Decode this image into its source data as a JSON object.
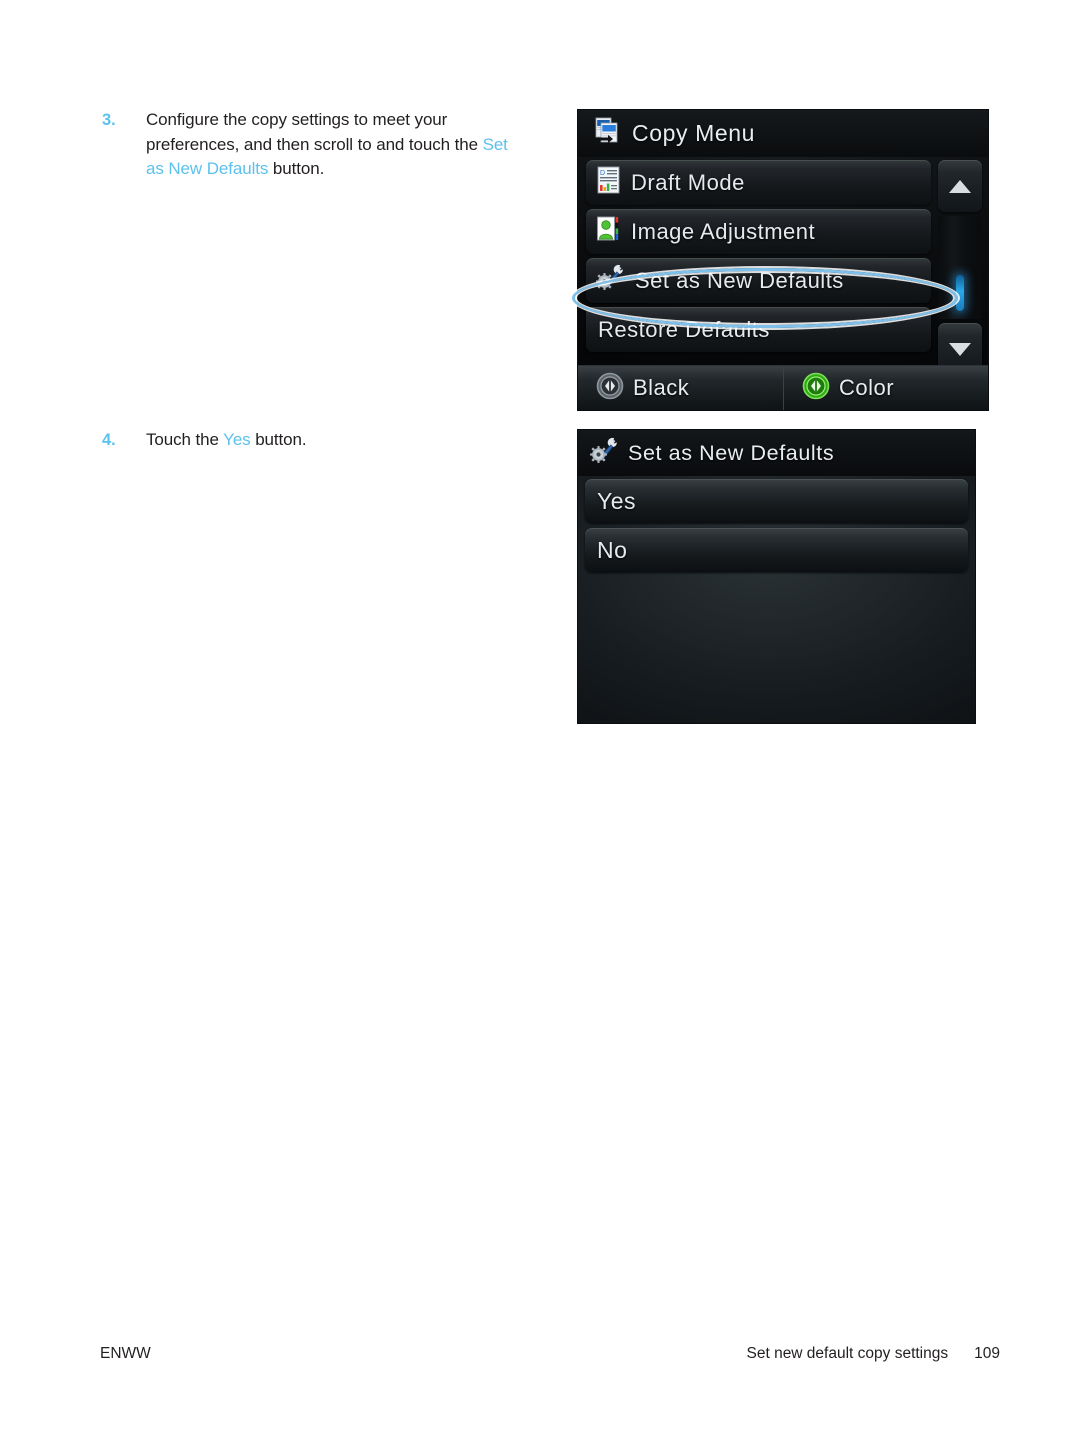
{
  "document": {
    "page_number": "109",
    "footer_left": "ENWW",
    "footer_right_title": "Set new default copy settings"
  },
  "colors": {
    "link_blue": "#5cc1ec",
    "highlight_ring": "#7ec0ea",
    "screen_text": "#e7ebee",
    "color_button_green": "#39c11c"
  },
  "steps": [
    {
      "number": "3.",
      "text_before": "Configure the copy settings to meet your preferences, and then scroll to and touch the ",
      "link": "Set as New Defaults",
      "text_after": " button."
    },
    {
      "number": "4.",
      "text_before": "Touch the ",
      "link": "Yes",
      "text_after": " button."
    }
  ],
  "screen_copy_menu": {
    "title": "Copy Menu",
    "title_icon": "copy-pages-icon",
    "items": [
      {
        "label": "Draft Mode",
        "icon": "document-draft-icon"
      },
      {
        "label": "Image Adjustment",
        "icon": "image-person-color-icon"
      },
      {
        "label": "Set as New Defaults",
        "icon": "wrench-gear-icon",
        "highlighted": true
      },
      {
        "label": "Restore Defaults",
        "icon": "none"
      }
    ],
    "scrollbar": {
      "up_icon": "triangle-up-icon",
      "down_icon": "triangle-down-icon",
      "thumb_position": "bottom"
    },
    "actions": [
      {
        "label": "Black",
        "icon": "start-black-icon"
      },
      {
        "label": "Color",
        "icon": "start-color-icon"
      }
    ]
  },
  "screen_set_defaults": {
    "title": "Set as New Defaults",
    "title_icon": "wrench-gear-icon",
    "options": [
      {
        "label": "Yes"
      },
      {
        "label": "No"
      }
    ]
  }
}
